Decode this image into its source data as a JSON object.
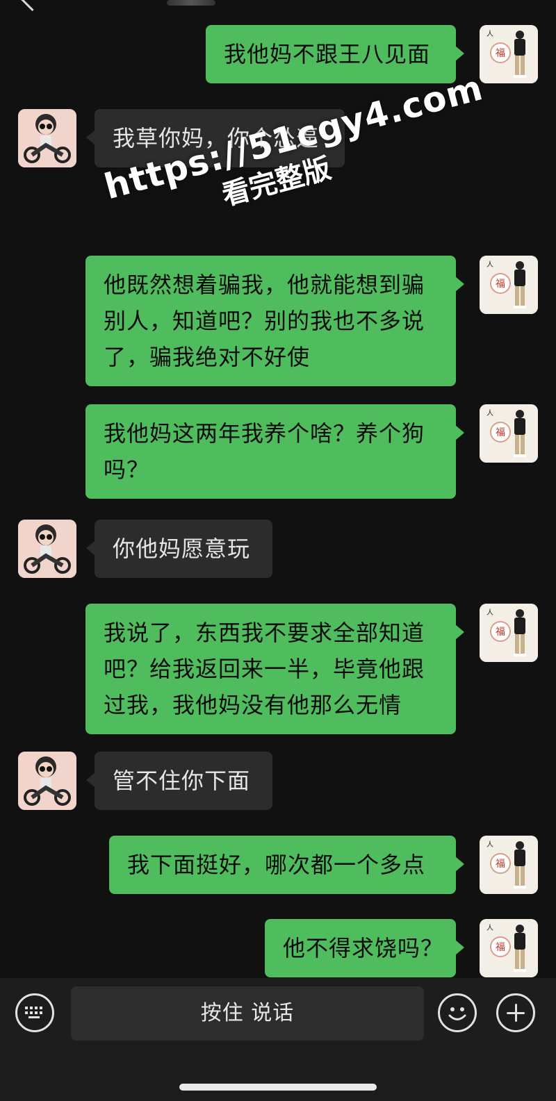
{
  "app": "WeChat chat",
  "icons": {
    "back": "back-chevron-icon",
    "keyboard": "keyboard-icon",
    "emoji": "emoji-smile-icon",
    "plus": "plus-circle-icon"
  },
  "colors": {
    "background": "#111111",
    "sent_bubble": "#4fbd5e",
    "received_bubble": "#2c2c2c"
  },
  "messages": [
    {
      "from": "me",
      "text": "我他妈不跟王八见面"
    },
    {
      "from": "them",
      "text": "我草你妈，你个怂逼"
    },
    {
      "from": "me",
      "text": "他既然想着骗我，他就能想到骗别人，知道吧？别的我也不多说了，骗我绝对不好使"
    },
    {
      "from": "me",
      "text": "我他妈这两年我养个啥？养个狗吗？"
    },
    {
      "from": "them",
      "text": "你他妈愿意玩"
    },
    {
      "from": "me",
      "text": "我说了，东西我不要求全部知道吧？给我返回来一半，毕竟他跟过我，我他妈没有他那么无情"
    },
    {
      "from": "them",
      "text": "管不住你下面"
    },
    {
      "from": "me",
      "text": "我下面挺好，哪次都一个多点"
    },
    {
      "from": "me",
      "text": "他不得求饶吗？"
    }
  ],
  "watermark": {
    "url": "https://51cgy4.com",
    "text": "看完整版"
  },
  "input_bar": {
    "voice_label": "按住 说话"
  }
}
